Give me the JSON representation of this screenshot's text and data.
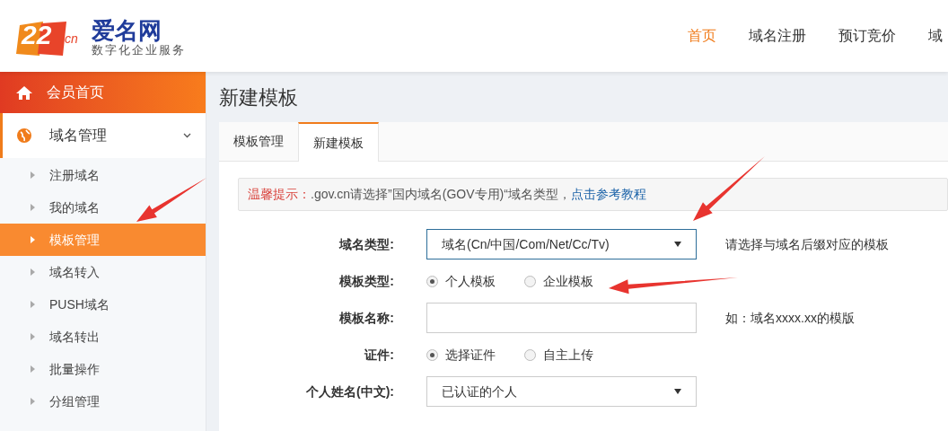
{
  "header": {
    "logo": {
      "mark": "22",
      "suffix": "cn",
      "name": "爱名网",
      "tagline": "数字化企业服务"
    },
    "nav": [
      {
        "label": "首页",
        "selected": true
      },
      {
        "label": "域名注册",
        "selected": false
      },
      {
        "label": "预订竞价",
        "selected": false
      },
      {
        "label": "域",
        "selected": false
      }
    ]
  },
  "sidebar": {
    "home": "会员首页",
    "group": {
      "label": "域名管理",
      "expanded": true,
      "items": [
        {
          "label": "注册域名",
          "selected": false
        },
        {
          "label": "我的域名",
          "selected": false
        },
        {
          "label": "模板管理",
          "selected": true
        },
        {
          "label": "域名转入",
          "selected": false
        },
        {
          "label": "PUSH域名",
          "selected": false
        },
        {
          "label": "域名转出",
          "selected": false
        },
        {
          "label": "批量操作",
          "selected": false
        },
        {
          "label": "分组管理",
          "selected": false
        }
      ]
    }
  },
  "page_title": "新建模板",
  "tabs": [
    {
      "label": "模板管理",
      "selected": false
    },
    {
      "label": "新建模板",
      "selected": true
    }
  ],
  "notice": {
    "prefix": "温馨提示：",
    "text": ".gov.cn请选择”国内域名(GOV专用)“域名类型，",
    "link": "点击参考教程"
  },
  "form": [
    {
      "kind": "select",
      "label": "域名类型:",
      "value": "域名(Cn/中国/Com/Net/Cc/Tv)",
      "focused": true,
      "hint": "请选择与域名后缀对应的模板"
    },
    {
      "kind": "radio",
      "label": "模板类型:",
      "options": [
        {
          "label": "个人模板",
          "selected": true
        },
        {
          "label": "企业模板",
          "selected": false
        }
      ]
    },
    {
      "kind": "text",
      "label": "模板名称:",
      "hint": "如：域名xxxx.xx的模版"
    },
    {
      "kind": "radio",
      "label": "证件:",
      "options": [
        {
          "label": "选择证件",
          "selected": true
        },
        {
          "label": "自主上传",
          "selected": false
        }
      ]
    },
    {
      "kind": "select",
      "label": "个人姓名(中文):",
      "value": "已认证的个人",
      "focused": false
    }
  ]
}
